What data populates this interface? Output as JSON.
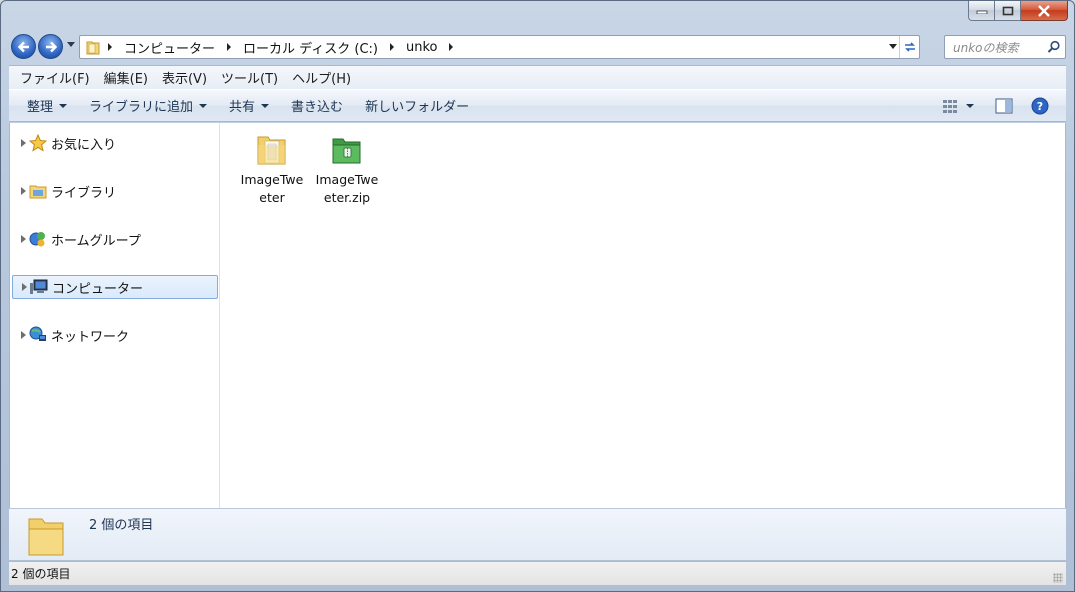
{
  "address": {
    "crumbs": [
      "コンピューター",
      "ローカル ディスク (C:)",
      "unko"
    ]
  },
  "search": {
    "placeholder": "unkoの検索"
  },
  "menu": [
    "ファイル(F)",
    "編集(E)",
    "表示(V)",
    "ツール(T)",
    "ヘルプ(H)"
  ],
  "commands": {
    "organize": "整理",
    "add_to_library": "ライブラリに追加",
    "share": "共有",
    "burn": "書き込む",
    "new_folder": "新しいフォルダー"
  },
  "nav": {
    "favorites": "お気に入り",
    "libraries": "ライブラリ",
    "homegroup": "ホームグループ",
    "computer": "コンピューター",
    "network": "ネットワーク"
  },
  "files": [
    {
      "name_line1": "ImageTwe",
      "name_line2": "eter",
      "icon": "folder-icon"
    },
    {
      "name_line1": "ImageTwe",
      "name_line2": "eter.zip",
      "icon": "zip-folder-icon"
    }
  ],
  "details": {
    "count_text": "2 個の項目"
  },
  "status": {
    "count_text": "2 個の項目"
  },
  "colors": {
    "accent": "#2d66c4",
    "selection": "#d9eafb",
    "close": "#c43b1c"
  }
}
